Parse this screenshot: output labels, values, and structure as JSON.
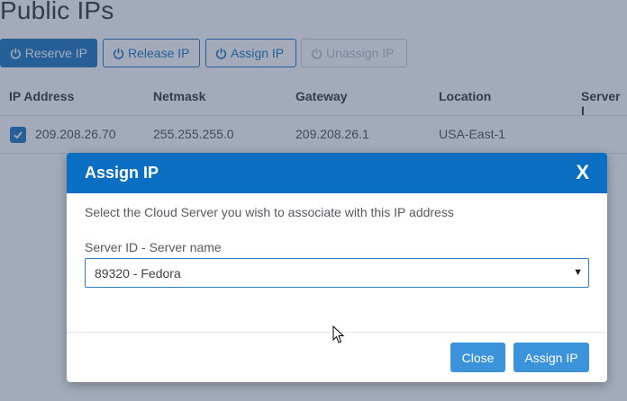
{
  "page": {
    "title": "Public IPs",
    "toolbar": {
      "reserve": "Reserve IP",
      "release": "Release IP",
      "assign": "Assign IP",
      "unassign": "Unassign IP"
    },
    "table": {
      "headers": [
        "IP Address",
        "Netmask",
        "Gateway",
        "Location",
        "Server I"
      ],
      "rows": [
        {
          "ip": "209.208.26.70",
          "netmask": "255.255.255.0",
          "gateway": "209.208.26.1",
          "location": "USA-East-1",
          "checked": true
        }
      ]
    }
  },
  "modal": {
    "title": "Assign IP",
    "close_symbol": "X",
    "description": "Select the Cloud Server you wish to associate with this IP address",
    "field_label": "Server ID - Server name",
    "selected_server": "89320 - Fedora",
    "close_label": "Close",
    "assign_label": "Assign IP"
  },
  "colors": {
    "primary": "#2a7cc7",
    "header": "#0a6fc2",
    "modal_button": "#3a93db"
  }
}
